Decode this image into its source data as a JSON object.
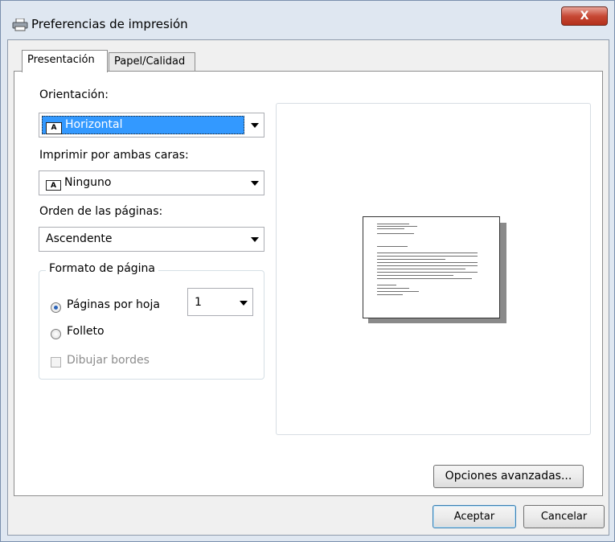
{
  "window": {
    "title": "Preferencias de impresión",
    "close_label": "X"
  },
  "tabs": [
    {
      "label": "Presentación",
      "active": true
    },
    {
      "label": "Papel/Calidad",
      "active": false
    }
  ],
  "orientation": {
    "label": "Orientación:",
    "value": "Horizontal",
    "icon": "A"
  },
  "duplex": {
    "label": "Imprimir por ambas caras:",
    "value": "Ninguno",
    "icon": "A"
  },
  "page_order": {
    "label": "Orden de las páginas:",
    "value": "Ascendente"
  },
  "page_format": {
    "group_title": "Formato de página",
    "pages_per_sheet_label": "Páginas por hoja",
    "pages_per_sheet_value": "1",
    "pages_per_sheet_selected": true,
    "booklet_label": "Folleto",
    "booklet_selected": false,
    "draw_borders_label": "Dibujar bordes",
    "draw_borders_checked": false,
    "draw_borders_enabled": false
  },
  "buttons": {
    "advanced": "Opciones avanzadas...",
    "ok": "Aceptar",
    "cancel": "Cancelar"
  }
}
